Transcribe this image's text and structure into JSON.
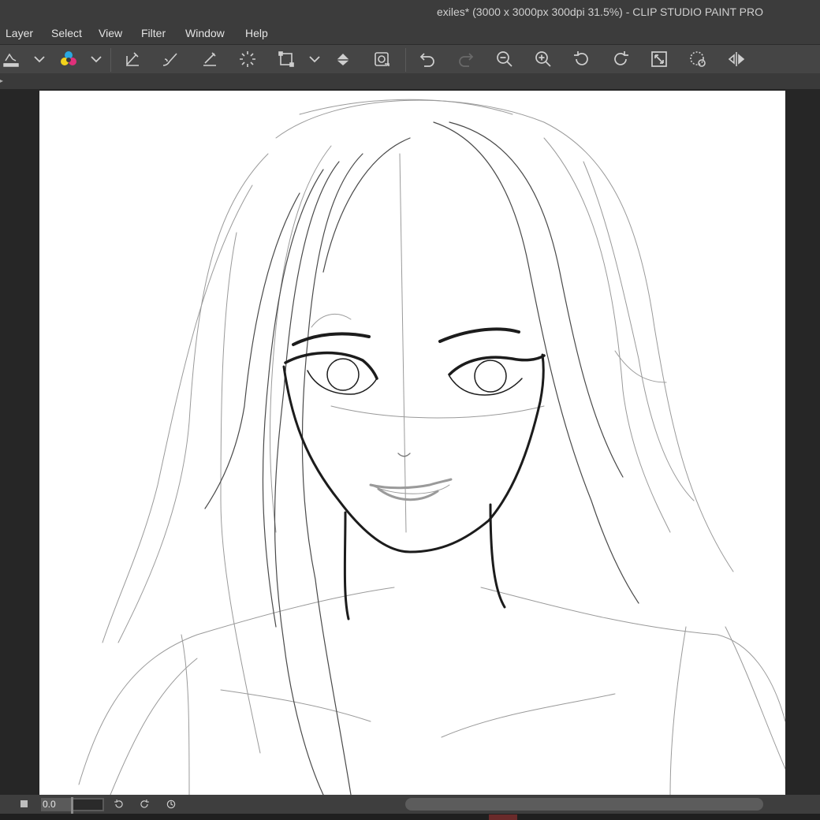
{
  "window": {
    "title": "exiles* (3000 x 3000px 300dpi 31.5%)  - CLIP STUDIO PAINT PRO"
  },
  "menu": {
    "items": [
      "Layer",
      "Select",
      "View",
      "Filter",
      "Window",
      "Help"
    ]
  },
  "toolbar": {
    "icons": [
      "fill-canvas-icon",
      "dropdown-icon",
      "color-mixing-icon",
      "dropdown-icon",
      "ruler-pen-icon",
      "brush-icon",
      "pen-icon",
      "selection-spin-icon",
      "transform-icon",
      "dropdown-icon",
      "fill-bucket-icon",
      "snap-icon",
      "undo-icon",
      "redo-icon",
      "zoom-out-icon",
      "zoom-in-icon",
      "rotate-left-icon",
      "rotate-right-icon",
      "fit-screen-icon",
      "rotate-reset-icon",
      "flip-horizontal-icon"
    ]
  },
  "statusbar": {
    "zoom_value": "0.0",
    "zoom_slider_fraction": 0.0
  },
  "colors": {
    "window_bg": "#2b2b2b",
    "bar_bg": "#3c3c3c",
    "toolbar_bg": "#454545",
    "canvas_bg": "#ffffff",
    "icon_color": "#cfcfcf"
  }
}
